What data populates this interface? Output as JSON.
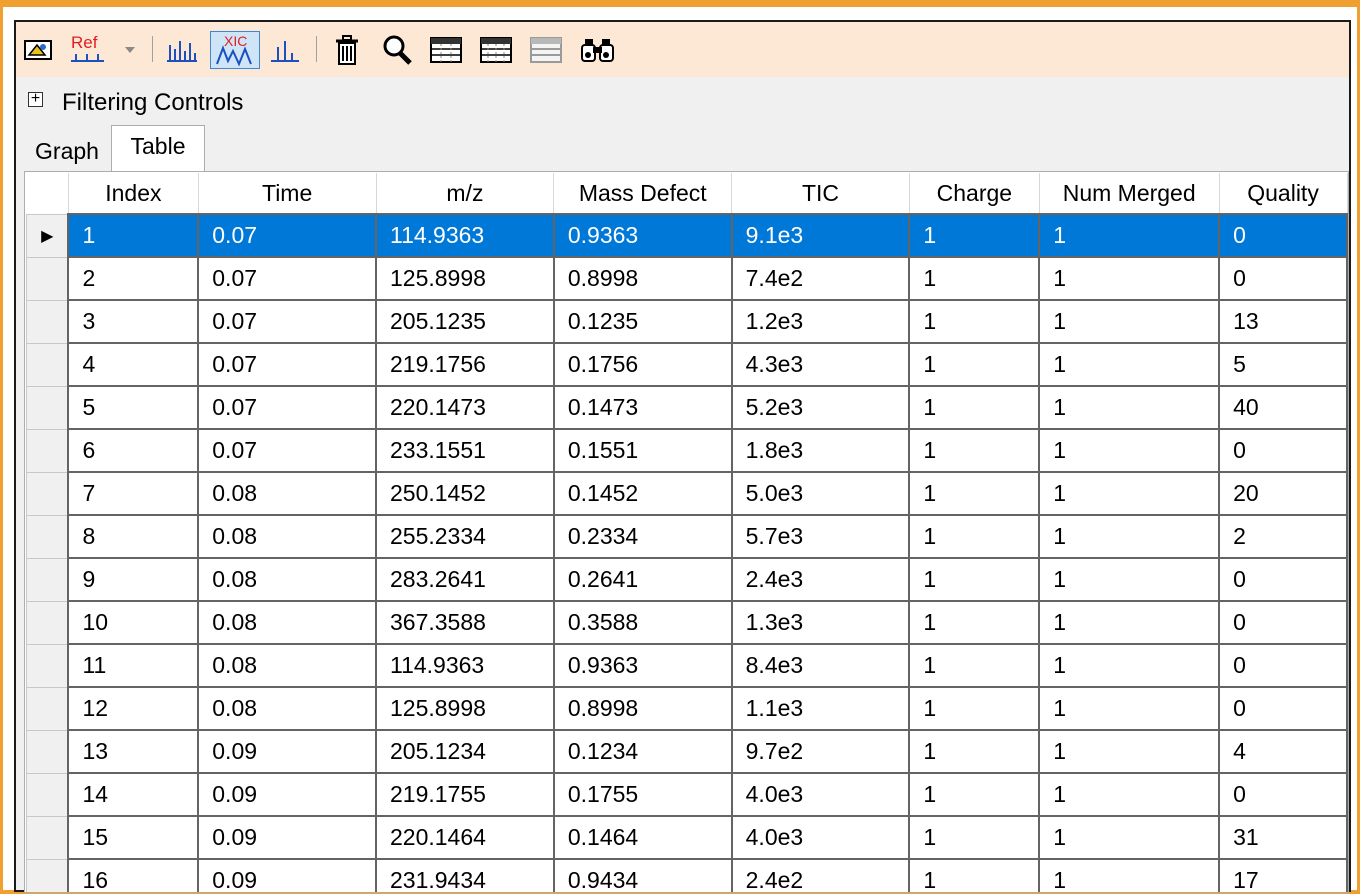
{
  "toolbar": {
    "ref_label": "Ref",
    "xic_label": "XIC",
    "icons": [
      "show-plot-icon",
      "ref-icon",
      "dropdown-arrow-icon",
      "spectrum-icon",
      "xic-icon",
      "peaks-icon",
      "trash-icon",
      "magnifier-icon",
      "table-icon",
      "table-alt-icon",
      "table-gray-icon",
      "binoculars-icon"
    ]
  },
  "filter": {
    "toggle": "+",
    "label": "Filtering Controls"
  },
  "tabs": [
    {
      "label": "Graph"
    },
    {
      "label": "Table"
    }
  ],
  "active_tab": "Table",
  "grid": {
    "row_marker": "▶",
    "columns": [
      "Index",
      "Time",
      "m/z",
      "Mass Defect",
      "TIC",
      "Charge",
      "Num Merged",
      "Quality"
    ],
    "rows": [
      [
        "1",
        "0.07",
        "114.9363",
        "0.9363",
        "9.1e3",
        "1",
        "1",
        "0"
      ],
      [
        "2",
        "0.07",
        "125.8998",
        "0.8998",
        "7.4e2",
        "1",
        "1",
        "0"
      ],
      [
        "3",
        "0.07",
        "205.1235",
        "0.1235",
        "1.2e3",
        "1",
        "1",
        "13"
      ],
      [
        "4",
        "0.07",
        "219.1756",
        "0.1756",
        "4.3e3",
        "1",
        "1",
        "5"
      ],
      [
        "5",
        "0.07",
        "220.1473",
        "0.1473",
        "5.2e3",
        "1",
        "1",
        "40"
      ],
      [
        "6",
        "0.07",
        "233.1551",
        "0.1551",
        "1.8e3",
        "1",
        "1",
        "0"
      ],
      [
        "7",
        "0.08",
        "250.1452",
        "0.1452",
        "5.0e3",
        "1",
        "1",
        "20"
      ],
      [
        "8",
        "0.08",
        "255.2334",
        "0.2334",
        "5.7e3",
        "1",
        "1",
        "2"
      ],
      [
        "9",
        "0.08",
        "283.2641",
        "0.2641",
        "2.4e3",
        "1",
        "1",
        "0"
      ],
      [
        "10",
        "0.08",
        "367.3588",
        "0.3588",
        "1.3e3",
        "1",
        "1",
        "0"
      ],
      [
        "11",
        "0.08",
        "114.9363",
        "0.9363",
        "8.4e3",
        "1",
        "1",
        "0"
      ],
      [
        "12",
        "0.08",
        "125.8998",
        "0.8998",
        "1.1e3",
        "1",
        "1",
        "0"
      ],
      [
        "13",
        "0.09",
        "205.1234",
        "0.1234",
        "9.7e2",
        "1",
        "1",
        "4"
      ],
      [
        "14",
        "0.09",
        "219.1755",
        "0.1755",
        "4.0e3",
        "1",
        "1",
        "0"
      ],
      [
        "15",
        "0.09",
        "220.1464",
        "0.1464",
        "4.0e3",
        "1",
        "1",
        "31"
      ],
      [
        "16",
        "0.09",
        "231.9434",
        "0.9434",
        "2.4e2",
        "1",
        "1",
        "17"
      ]
    ],
    "selected_row": 1
  },
  "colors": {
    "window_border": "#f0a030",
    "toolbar_bg": "#fde8d6",
    "selection": "#0078d7",
    "active_button_bg": "#cfe4f7"
  }
}
